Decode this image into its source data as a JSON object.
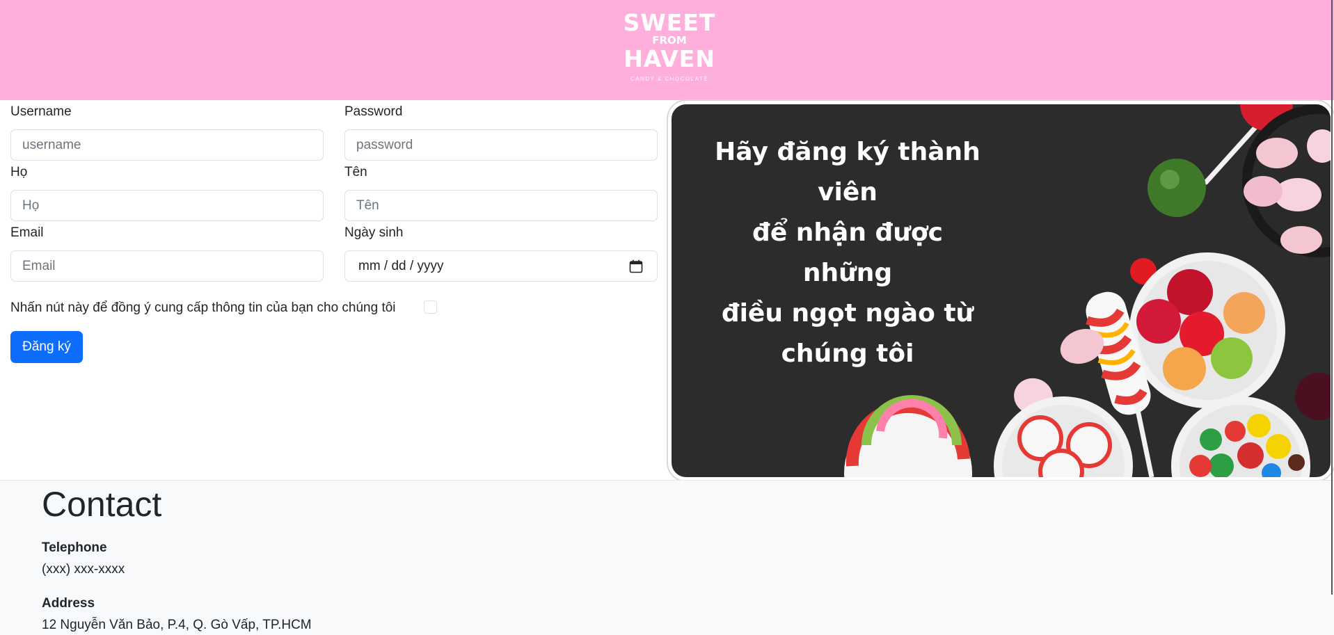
{
  "header": {
    "logo": {
      "line1": "SWEET",
      "line2": "FROM",
      "line3": "HAVEN",
      "tagline": "CANDY & CHOCOLATE"
    }
  },
  "form": {
    "username": {
      "label": "Username",
      "placeholder": "username",
      "value": ""
    },
    "password": {
      "label": "Password",
      "placeholder": "password",
      "value": ""
    },
    "last_name": {
      "label": "Họ",
      "placeholder": "Họ",
      "value": ""
    },
    "first_name": {
      "label": "Tên",
      "placeholder": "Tên",
      "value": ""
    },
    "email": {
      "label": "Email",
      "placeholder": "Email",
      "value": ""
    },
    "birthday": {
      "label": "Ngày sinh",
      "value": "mm / dd / yyyy",
      "icon": "calendar-icon"
    },
    "consent_text": "Nhấn nút này để đồng ý cung cấp thông tin của bạn cho chúng tôi",
    "consent_checked": false,
    "submit_label": "Đăng ký",
    "accent_color": "#0d6efd"
  },
  "promo": {
    "lines": [
      "Hãy đăng ký thành viên",
      "để nhận được những",
      "điều ngọt ngào từ",
      "chúng tôi"
    ]
  },
  "contact": {
    "title": "Contact",
    "telephone_label": "Telephone",
    "telephone_value": "(xxx) xxx-xxxx",
    "address_label": "Address",
    "address_value": "12 Nguyễn Văn Bảo, P.4, Q. Gò Vấp, TP.HCM"
  },
  "colors": {
    "header_bg": "#ffafdc",
    "promo_bg": "#2c2c2c",
    "contact_bg": "#f8f9fa"
  }
}
